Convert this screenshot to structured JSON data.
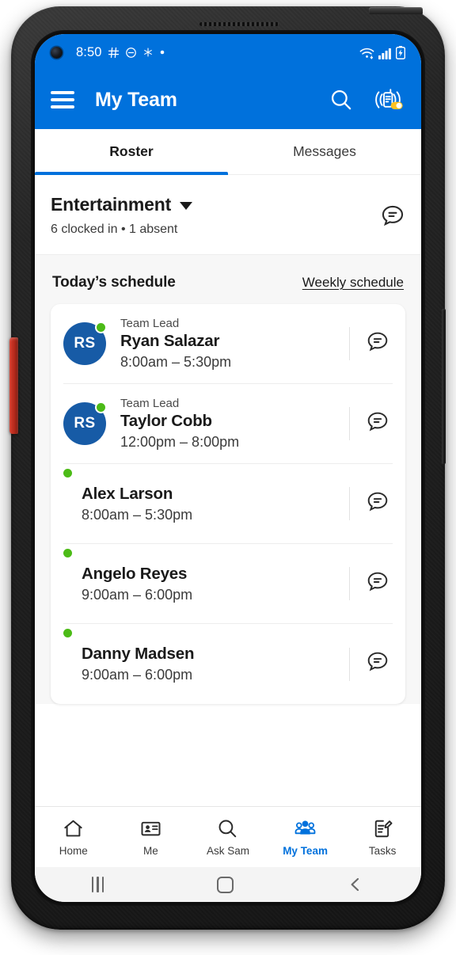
{
  "status_bar": {
    "time": "8:50",
    "left_icons": [
      "slack-icon",
      "do-not-disturb-icon",
      "asterisk-icon",
      "dot-icon"
    ],
    "right_icons": [
      "wifi-icon",
      "cellular-signal-icon",
      "battery-charging-icon"
    ]
  },
  "app_bar": {
    "title": "My Team",
    "menu_icon": "hamburger-menu-icon",
    "search_icon": "search-icon",
    "walkie_talkie_icon": "walkie-talkie-icon"
  },
  "tabs": [
    {
      "label": "Roster",
      "active": true
    },
    {
      "label": "Messages",
      "active": false
    }
  ],
  "department": {
    "name": "Entertainment",
    "status": "6 clocked in  •  1 absent",
    "clocked_in": 6,
    "absent": 1,
    "chat_icon": "chat-bubble-icon"
  },
  "schedule": {
    "title": "Today’s schedule",
    "weekly_link": "Weekly schedule",
    "rows": [
      {
        "role": "Team Lead",
        "name": "Ryan Salazar",
        "time": "8:00am – 5:30pm",
        "initials": "RS",
        "online": true,
        "has_avatar": true
      },
      {
        "role": "Team Lead",
        "name": "Taylor Cobb",
        "time": "12:00pm – 8:00pm",
        "initials": "RS",
        "online": true,
        "has_avatar": true
      },
      {
        "role": "",
        "name": "Alex Larson",
        "time": "8:00am – 5:30pm",
        "initials": "",
        "online": true,
        "has_avatar": false
      },
      {
        "role": "",
        "name": "Angelo Reyes",
        "time": "9:00am – 6:00pm",
        "initials": "",
        "online": true,
        "has_avatar": false
      },
      {
        "role": "",
        "name": "Danny Madsen",
        "time": "9:00am – 6:00pm",
        "initials": "",
        "online": true,
        "has_avatar": false
      }
    ]
  },
  "bottom_nav": [
    {
      "label": "Home",
      "icon": "home-icon",
      "active": false
    },
    {
      "label": "Me",
      "icon": "badge-id-icon",
      "active": false
    },
    {
      "label": "Ask Sam",
      "icon": "search-icon",
      "active": false
    },
    {
      "label": "My Team",
      "icon": "people-icon",
      "active": true
    },
    {
      "label": "Tasks",
      "icon": "note-pencil-icon",
      "active": false
    }
  ],
  "system_nav": {
    "recents_icon": "recents-icon",
    "home_icon": "home-square-icon",
    "back_icon": "back-chevron-icon"
  },
  "colors": {
    "brand_blue": "#0071DC",
    "avatar_blue": "#175BA6",
    "online_green": "#4CBB17",
    "accent_yellow": "#FFC220",
    "text_dark": "#1A1A1A",
    "bg_gray": "#F7F7F7"
  }
}
